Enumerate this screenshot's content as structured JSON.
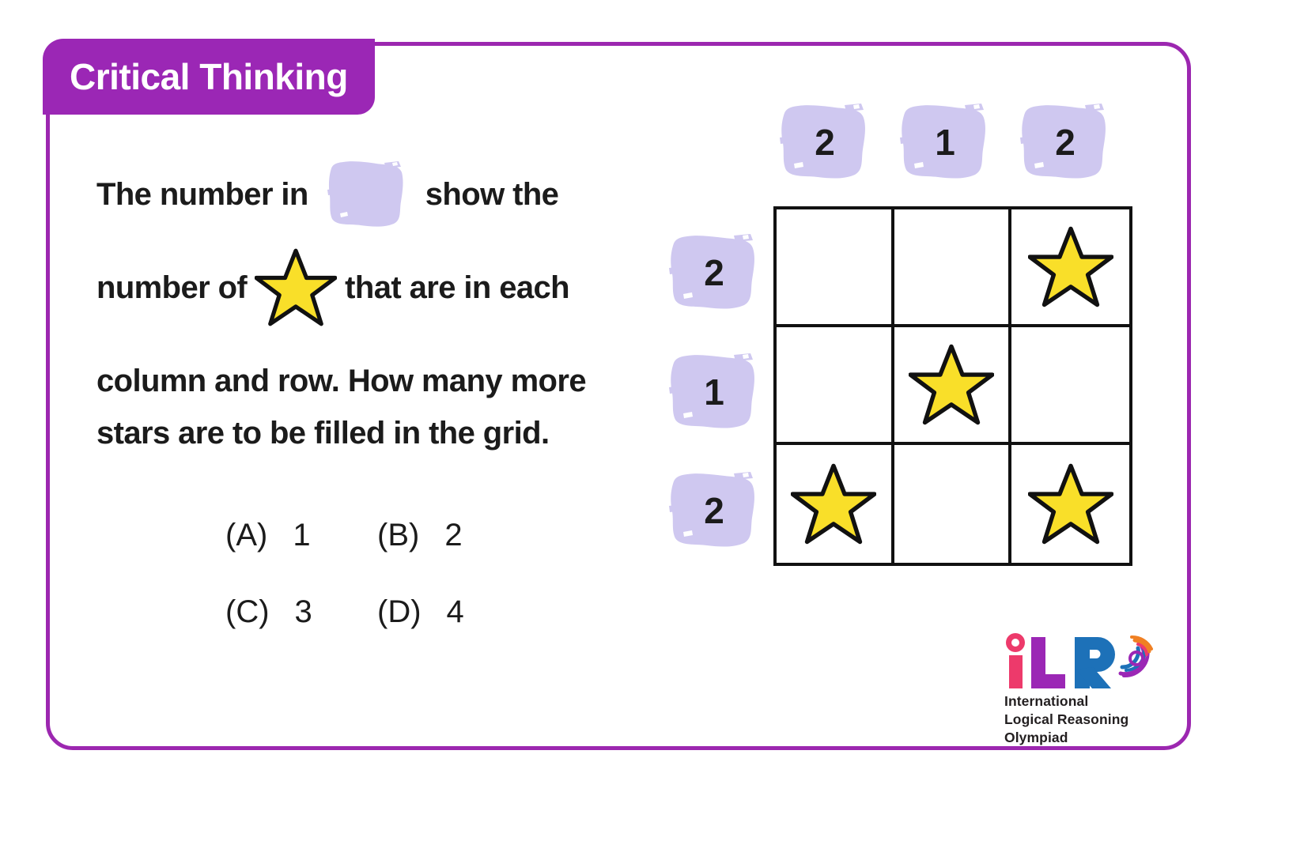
{
  "card": {
    "category_tab_label": "Critical Thinking",
    "border_color": "#9C27B0",
    "tab_color": "#9B27B5"
  },
  "question": {
    "line1_part1": "The number in",
    "line1_inline_icon": "lavender-brush-patch",
    "line1_part2": "show the",
    "line2_part1": "number of",
    "line2_inline_icon": "yellow-star",
    "line2_part2": "that are in each",
    "line3": "column and row. How many more",
    "line4": "stars are to be filled in the grid."
  },
  "options": [
    {
      "letter": "(A)",
      "value": "1"
    },
    {
      "letter": "(B)",
      "value": "2"
    },
    {
      "letter": "(C)",
      "value": "3"
    },
    {
      "letter": "(D)",
      "value": "4"
    }
  ],
  "puzzle": {
    "column_labels": [
      "2",
      "1",
      "2"
    ],
    "row_labels": [
      "2",
      "1",
      "2"
    ],
    "grid": [
      [
        "empty",
        "empty",
        "star"
      ],
      [
        "empty",
        "star",
        "empty"
      ],
      [
        "star",
        "empty",
        "star"
      ]
    ],
    "star_fill_color": "#F9DF29",
    "star_stroke_color": "#111111",
    "label_patch_color": "#CFC8F0",
    "grid_line_color": "#111111"
  },
  "logo": {
    "letters": [
      {
        "char": "i",
        "color": "#ED3A6B"
      },
      {
        "char": "L",
        "color": "#9B27B5"
      },
      {
        "char": "R",
        "color": "#1D71B8"
      }
    ],
    "tagline_line1": "International",
    "tagline_line2": "Logical Reasoning",
    "tagline_line3": "Olympiad",
    "swirl_colors": [
      "#9B27B5",
      "#1D71B8",
      "#F08023",
      "#ED3A6B"
    ]
  }
}
